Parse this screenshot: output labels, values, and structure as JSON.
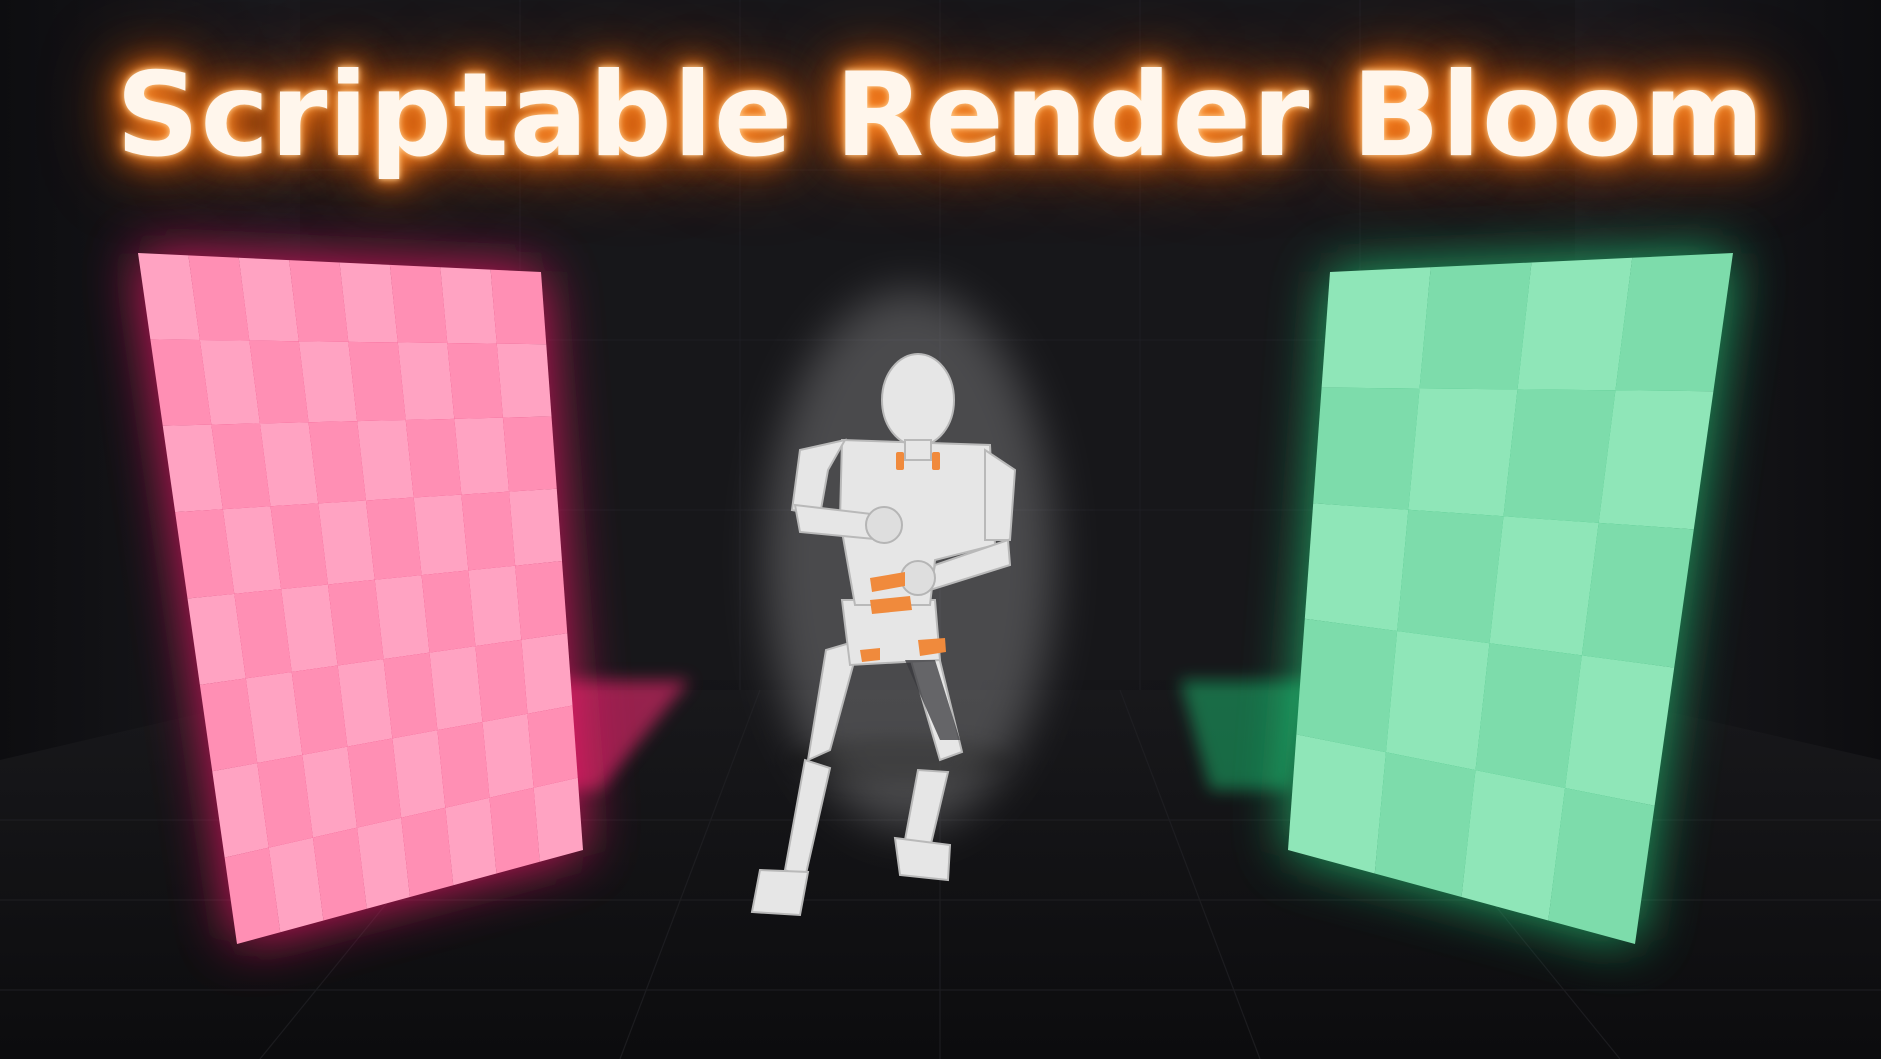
{
  "title": "Scriptable Render Bloom",
  "colors": {
    "background": "#0b0b0d",
    "title_glow": "#ff7a1a",
    "pink_panel_light": "#ffa3c2",
    "pink_panel_dark": "#ff8fb4",
    "pink_glow": "#ff1f6e",
    "green_panel_light": "#8fe6b8",
    "green_panel_dark": "#7ddcab",
    "green_glow": "#21d47e",
    "mannequin_body": "#e8e8e8",
    "mannequin_accent": "#f08a3c"
  },
  "scene": {
    "left_panel": "pink-checker-panel",
    "right_panel": "green-checker-panel",
    "character": "mannequin-dancing"
  }
}
